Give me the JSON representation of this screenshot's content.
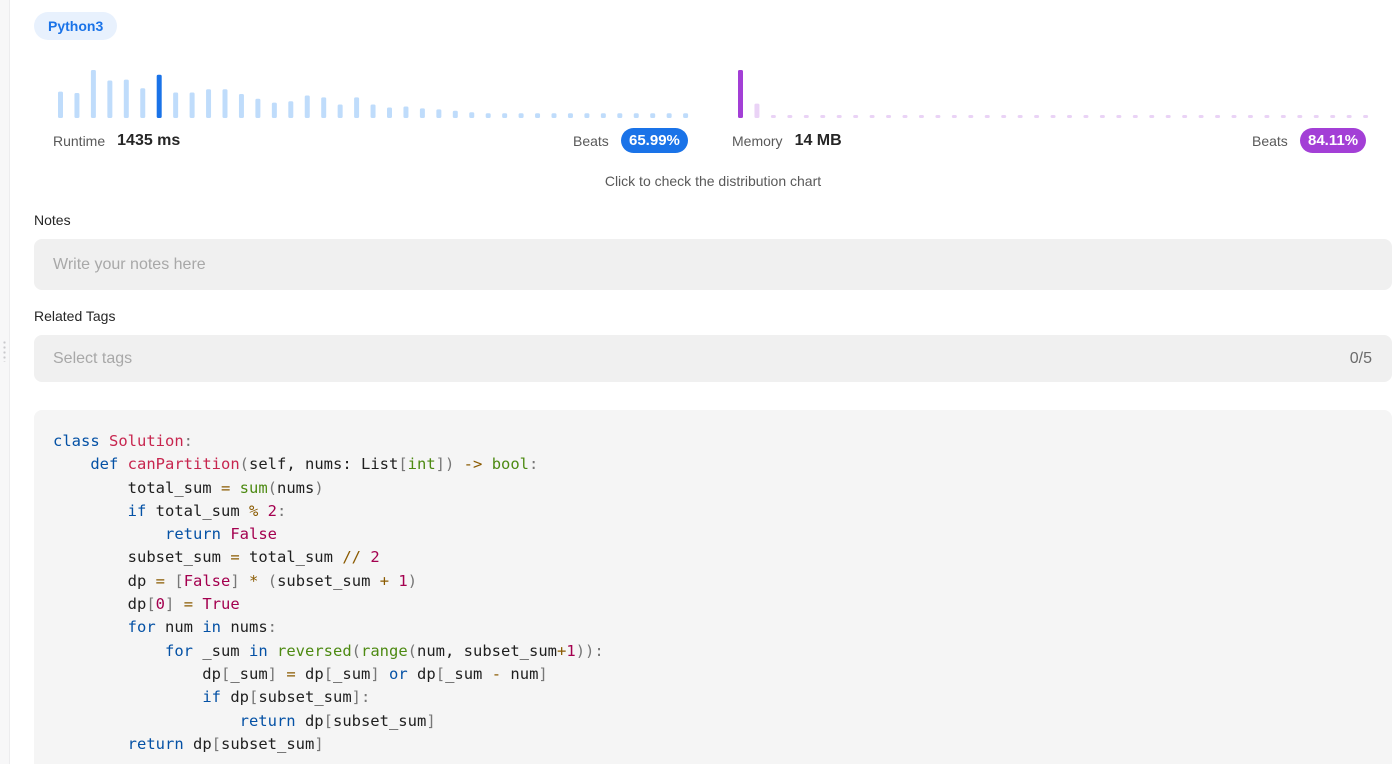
{
  "language_pill": "Python3",
  "runtime": {
    "label": "Runtime",
    "value": "1435 ms",
    "beats_label": "Beats",
    "beats_pct": "65.99%",
    "accent": "#1a73e8",
    "bar_color": "#bfdcfb",
    "highlight_index": 6,
    "bar_heights_rel": [
      0.55,
      0.52,
      1.0,
      0.78,
      0.8,
      0.62,
      0.9,
      0.53,
      0.53,
      0.6,
      0.6,
      0.5,
      0.4,
      0.32,
      0.35,
      0.47,
      0.43,
      0.28,
      0.43,
      0.28,
      0.22,
      0.24,
      0.2,
      0.18,
      0.15,
      0.12,
      0.1,
      0.1,
      0.1,
      0.1,
      0.1,
      0.1,
      0.1,
      0.1,
      0.1,
      0.1,
      0.1,
      0.1,
      0.1
    ]
  },
  "memory": {
    "label": "Memory",
    "value": "14 MB",
    "beats_label": "Beats",
    "beats_pct": "84.11%",
    "accent": "#a33fd6",
    "bar_color": "#ead3f6",
    "highlight_index": 0,
    "bar_heights_rel": [
      1.0,
      0.3,
      0.06,
      0.06,
      0.06,
      0.06,
      0.06,
      0.06,
      0.06,
      0.06,
      0.06,
      0.06,
      0.06,
      0.06,
      0.06,
      0.06,
      0.06,
      0.06,
      0.06,
      0.06,
      0.06,
      0.06,
      0.06,
      0.06,
      0.06,
      0.06,
      0.06,
      0.06,
      0.06,
      0.06,
      0.06,
      0.06,
      0.06,
      0.06,
      0.06,
      0.06,
      0.06,
      0.06,
      0.06
    ]
  },
  "distribution_hint": "Click to check the distribution chart",
  "notes": {
    "title": "Notes",
    "placeholder": "Write your notes here"
  },
  "related_tags": {
    "title": "Related Tags",
    "placeholder": "Select tags",
    "count": "0/5"
  },
  "code_lines": [
    [
      [
        "kw",
        "class"
      ],
      [
        "id",
        " "
      ],
      [
        "cls",
        "Solution"
      ],
      [
        "p",
        ":"
      ]
    ],
    [
      [
        "id",
        "    "
      ],
      [
        "kw",
        "def"
      ],
      [
        "id",
        " "
      ],
      [
        "fn",
        "canPartition"
      ],
      [
        "p",
        "("
      ],
      [
        "id",
        "self, nums: List"
      ],
      [
        "p",
        "["
      ],
      [
        "bi",
        "int"
      ],
      [
        "p",
        "])"
      ],
      [
        "id",
        " "
      ],
      [
        "op",
        "->"
      ],
      [
        "id",
        " "
      ],
      [
        "bi",
        "bool"
      ],
      [
        "p",
        ":"
      ]
    ],
    [
      [
        "id",
        "        total_sum "
      ],
      [
        "op",
        "="
      ],
      [
        "id",
        " "
      ],
      [
        "bi",
        "sum"
      ],
      [
        "p",
        "("
      ],
      [
        "id",
        "nums"
      ],
      [
        "p",
        ")"
      ]
    ],
    [
      [
        "id",
        "        "
      ],
      [
        "kw",
        "if"
      ],
      [
        "id",
        " total_sum "
      ],
      [
        "op",
        "%"
      ],
      [
        "id",
        " "
      ],
      [
        "num",
        "2"
      ],
      [
        "p",
        ":"
      ]
    ],
    [
      [
        "id",
        "            "
      ],
      [
        "kw",
        "return"
      ],
      [
        "id",
        " "
      ],
      [
        "const",
        "False"
      ]
    ],
    [
      [
        "id",
        "        subset_sum "
      ],
      [
        "op",
        "="
      ],
      [
        "id",
        " total_sum "
      ],
      [
        "op",
        "//"
      ],
      [
        "id",
        " "
      ],
      [
        "num",
        "2"
      ]
    ],
    [
      [
        "id",
        "        dp "
      ],
      [
        "op",
        "="
      ],
      [
        "id",
        " "
      ],
      [
        "p",
        "["
      ],
      [
        "const",
        "False"
      ],
      [
        "p",
        "]"
      ],
      [
        "id",
        " "
      ],
      [
        "op",
        "*"
      ],
      [
        "id",
        " "
      ],
      [
        "p",
        "("
      ],
      [
        "id",
        "subset_sum "
      ],
      [
        "op",
        "+"
      ],
      [
        "id",
        " "
      ],
      [
        "num",
        "1"
      ],
      [
        "p",
        ")"
      ]
    ],
    [
      [
        "id",
        "        dp"
      ],
      [
        "p",
        "["
      ],
      [
        "num",
        "0"
      ],
      [
        "p",
        "]"
      ],
      [
        "id",
        " "
      ],
      [
        "op",
        "="
      ],
      [
        "id",
        " "
      ],
      [
        "const",
        "True"
      ]
    ],
    [
      [
        "id",
        "        "
      ],
      [
        "kw",
        "for"
      ],
      [
        "id",
        " num "
      ],
      [
        "kw",
        "in"
      ],
      [
        "id",
        " nums"
      ],
      [
        "p",
        ":"
      ]
    ],
    [
      [
        "id",
        "            "
      ],
      [
        "kw",
        "for"
      ],
      [
        "id",
        " _sum "
      ],
      [
        "kw",
        "in"
      ],
      [
        "id",
        " "
      ],
      [
        "bi",
        "reversed"
      ],
      [
        "p",
        "("
      ],
      [
        "bi",
        "range"
      ],
      [
        "p",
        "("
      ],
      [
        "id",
        "num, subset_sum"
      ],
      [
        "op",
        "+"
      ],
      [
        "num",
        "1"
      ],
      [
        "p",
        "))"
      ],
      [
        "p",
        ":"
      ]
    ],
    [
      [
        "id",
        "                dp"
      ],
      [
        "p",
        "["
      ],
      [
        "id",
        "_sum"
      ],
      [
        "p",
        "]"
      ],
      [
        "id",
        " "
      ],
      [
        "op",
        "="
      ],
      [
        "id",
        " dp"
      ],
      [
        "p",
        "["
      ],
      [
        "id",
        "_sum"
      ],
      [
        "p",
        "]"
      ],
      [
        "id",
        " "
      ],
      [
        "kw",
        "or"
      ],
      [
        "id",
        " dp"
      ],
      [
        "p",
        "["
      ],
      [
        "id",
        "_sum "
      ],
      [
        "op",
        "-"
      ],
      [
        "id",
        " num"
      ],
      [
        "p",
        "]"
      ]
    ],
    [
      [
        "id",
        "                "
      ],
      [
        "kw",
        "if"
      ],
      [
        "id",
        " dp"
      ],
      [
        "p",
        "["
      ],
      [
        "id",
        "subset_sum"
      ],
      [
        "p",
        "]"
      ],
      [
        "p",
        ":"
      ]
    ],
    [
      [
        "id",
        "                    "
      ],
      [
        "kw",
        "return"
      ],
      [
        "id",
        " dp"
      ],
      [
        "p",
        "["
      ],
      [
        "id",
        "subset_sum"
      ],
      [
        "p",
        "]"
      ]
    ],
    [
      [
        "id",
        "        "
      ],
      [
        "kw",
        "return"
      ],
      [
        "id",
        " dp"
      ],
      [
        "p",
        "["
      ],
      [
        "id",
        "subset_sum"
      ],
      [
        "p",
        "]"
      ]
    ]
  ]
}
